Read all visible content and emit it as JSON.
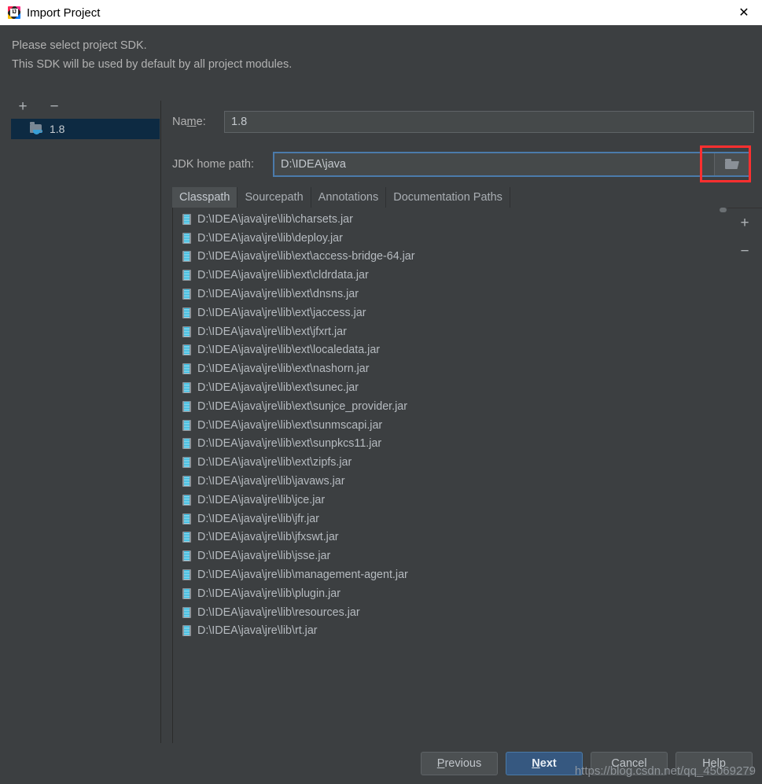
{
  "window": {
    "title": "Import Project",
    "app_icon": "intellij-idea-icon",
    "close_icon": "close-icon"
  },
  "prompt": {
    "line1": "Please select project SDK.",
    "line2": "This SDK will be used by default by all project modules."
  },
  "sdk_panel": {
    "add_label": "+",
    "remove_label": "−",
    "items": [
      {
        "label": "1.8",
        "icon": "jdk-folder-icon",
        "selected": true
      }
    ]
  },
  "fields": {
    "name": {
      "label": "Name:",
      "mnemonic": "m",
      "value": "1.8",
      "placeholder": "Name"
    },
    "jdk_home_path": {
      "label": "JDK home path:",
      "value": "D:\\IDEA\\java",
      "placeholder": "JDK home path",
      "browse_icon": "folder-open-icon",
      "focus_border_color": "#4b7bab",
      "annotation_color": "#ff2f2f"
    }
  },
  "tabs": [
    {
      "label": "Classpath",
      "active": true
    },
    {
      "label": "Sourcepath",
      "active": false
    },
    {
      "label": "Annotations",
      "active": false
    },
    {
      "label": "Documentation Paths",
      "active": false
    }
  ],
  "classpath": {
    "add_label": "+",
    "remove_label": "−",
    "entries": [
      "D:\\IDEA\\java\\jre\\lib\\charsets.jar",
      "D:\\IDEA\\java\\jre\\lib\\deploy.jar",
      "D:\\IDEA\\java\\jre\\lib\\ext\\access-bridge-64.jar",
      "D:\\IDEA\\java\\jre\\lib\\ext\\cldrdata.jar",
      "D:\\IDEA\\java\\jre\\lib\\ext\\dnsns.jar",
      "D:\\IDEA\\java\\jre\\lib\\ext\\jaccess.jar",
      "D:\\IDEA\\java\\jre\\lib\\ext\\jfxrt.jar",
      "D:\\IDEA\\java\\jre\\lib\\ext\\localedata.jar",
      "D:\\IDEA\\java\\jre\\lib\\ext\\nashorn.jar",
      "D:\\IDEA\\java\\jre\\lib\\ext\\sunec.jar",
      "D:\\IDEA\\java\\jre\\lib\\ext\\sunjce_provider.jar",
      "D:\\IDEA\\java\\jre\\lib\\ext\\sunmscapi.jar",
      "D:\\IDEA\\java\\jre\\lib\\ext\\sunpkcs11.jar",
      "D:\\IDEA\\java\\jre\\lib\\ext\\zipfs.jar",
      "D:\\IDEA\\java\\jre\\lib\\javaws.jar",
      "D:\\IDEA\\java\\jre\\lib\\jce.jar",
      "D:\\IDEA\\java\\jre\\lib\\jfr.jar",
      "D:\\IDEA\\java\\jre\\lib\\jfxswt.jar",
      "D:\\IDEA\\java\\jre\\lib\\jsse.jar",
      "D:\\IDEA\\java\\jre\\lib\\management-agent.jar",
      "D:\\IDEA\\java\\jre\\lib\\plugin.jar",
      "D:\\IDEA\\java\\jre\\lib\\resources.jar",
      "D:\\IDEA\\java\\jre\\lib\\rt.jar"
    ]
  },
  "footer": {
    "previous": {
      "text": "Previous",
      "mnemonic": "P"
    },
    "next": {
      "text": "Next",
      "mnemonic": "N",
      "primary": true
    },
    "cancel": {
      "text": "Cancel"
    },
    "help": {
      "text": "Help"
    }
  },
  "watermark": "https://blog.csdn.net/qq_45069279"
}
